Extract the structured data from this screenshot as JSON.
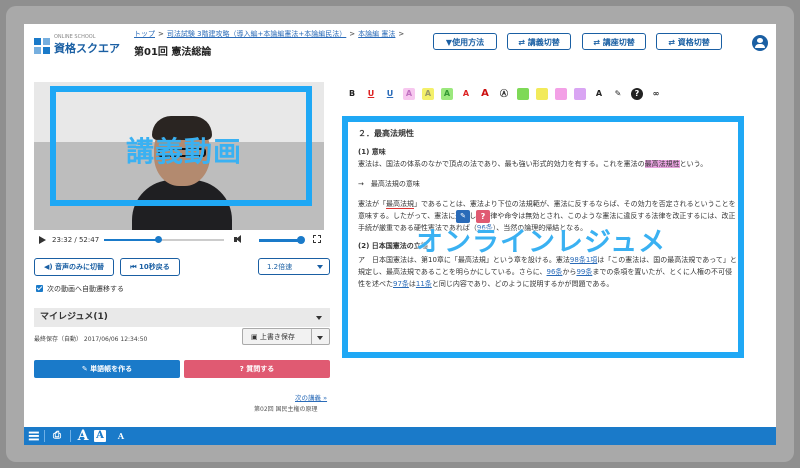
{
  "header": {
    "logo_small": "ONLINE SCHOOL",
    "logo_name": "資格スクエア",
    "breadcrumb": [
      "トップ",
      "司法試験 3階建攻略（導入編+本論編憲法+本論編民法）",
      "本論編 憲法"
    ],
    "lecture_title": "第01回 憲法総論",
    "buttons": {
      "usage": "▼使用方法",
      "lecture_switch": "⇄ 講義切替",
      "course_switch": "⇄ 講座切替",
      "qualification_switch": "⇄ 資格切替"
    },
    "user_icon": "user-icon"
  },
  "video": {
    "caption": "講義動画",
    "time": "23:32 / 52:47",
    "progress": 0.45,
    "volume": 1.0
  },
  "controls": {
    "audio_only": "音声のみに切替",
    "back10": "10秒戻る",
    "speed": "1.2倍速",
    "autoplay_label": "次の動画へ自動遷移する",
    "autoplay_checked": true
  },
  "resume": {
    "title": "マイレジュメ(1)",
    "autosave": "最終保存（自動） 2017/06/06 12:34:50",
    "overwrite": "上書き保存",
    "vocab_button": "単語帳を作る",
    "question_button": "質問する",
    "accent_blue": "#1a7ac9",
    "accent_red": "#e05a72"
  },
  "next": {
    "link": "次の講義 »",
    "title": "第02回 国民主権の原理"
  },
  "toolbar": {
    "tools": [
      {
        "name": "bold-tool",
        "glyph": "B",
        "color": "#222",
        "bg": ""
      },
      {
        "name": "underline-red-tool",
        "glyph": "U",
        "color": "#d22",
        "bg": ""
      },
      {
        "name": "underline-blue-tool",
        "glyph": "U",
        "color": "#2a6bb8",
        "bg": ""
      },
      {
        "name": "highlight-pink-tool",
        "glyph": "A",
        "color": "#c070c0",
        "bg": "#f7c7ef"
      },
      {
        "name": "highlight-yellow-tool",
        "glyph": "A",
        "color": "#996",
        "bg": "#f4f06a"
      },
      {
        "name": "highlight-green-tool",
        "glyph": "A",
        "color": "#393",
        "bg": "#9be87d"
      },
      {
        "name": "text-red-tool",
        "glyph": "A",
        "color": "#d22",
        "bg": ""
      },
      {
        "name": "text-large-tool",
        "glyph": "A",
        "color": "#c11",
        "bg": ""
      },
      {
        "name": "circle-tool",
        "glyph": "Ⓐ",
        "color": "#222",
        "bg": ""
      },
      {
        "name": "sticky-green-tool",
        "glyph": "",
        "color": "#222",
        "bg": "#7ed957"
      },
      {
        "name": "sticky-yellow-tool",
        "glyph": "",
        "color": "#222",
        "bg": "#f2ea5a"
      },
      {
        "name": "sticky-pink-tool",
        "glyph": "",
        "color": "#222",
        "bg": "#f3a0e6"
      },
      {
        "name": "sticky-purple-tool",
        "glyph": "",
        "color": "#222",
        "bg": "#d9a5f3"
      },
      {
        "name": "text-size-tool",
        "glyph": "A",
        "color": "#222",
        "bg": ""
      },
      {
        "name": "vocab-tool",
        "glyph": "✎",
        "color": "#222",
        "bg": ""
      },
      {
        "name": "question-tool",
        "glyph": "?",
        "color": "#fff",
        "bg": "#222"
      },
      {
        "name": "link-tool",
        "glyph": "∞",
        "color": "#222",
        "bg": ""
      }
    ]
  },
  "document": {
    "overlay_caption": "オンラインレジュメ",
    "heading": "２．最高法規性",
    "sub1": "(1) 意味",
    "para1_before": "憲法は、国法の体系のなかで頂点の法であり、最も強い形式的効力を有する。これを憲法の",
    "para1_highlight": "最高法規性",
    "para1_after": "という。",
    "arrow_line": "→　最高法規の意味",
    "para2_a": "憲法が「",
    "para2_hl": "最高法規",
    "para2_b": "」であることは、憲法より下位の法規範が、憲法に反するならば、その効力を否定されるということを意味する。したがって、憲法に違反した法律や命令は無効とされ、このような憲法に違反する法律を改正するには、改正手続が厳重である硬性憲法であれば（",
    "para2_link": "96条",
    "para2_c": "）、当然の論理的帰結となる。",
    "sub2": "(2) 日本国憲法の立場",
    "para3_a": "ア　日本国憲法は、第10章に「最高法規」という章を設ける。憲法",
    "para3_link1": "98条1項",
    "para3_b": "は「この憲法は、国の最高法規であって」と規定し、最高法規であることを明らかにしている。さらに、",
    "para3_link2": "96条",
    "para3_c": "から",
    "para3_link3": "99条",
    "para3_d": "までの条項を置いたが、とくに人権の不可侵性を述べた",
    "para3_link4": "97条",
    "para3_e": "は",
    "para3_link5": "11条",
    "para3_f": "と同じ内容であり、どのように説明するかが問題である。"
  },
  "bottombar": {
    "menu_icon": "menu-icon",
    "print_icon": "print-icon",
    "font_large": "A",
    "font_medium": "A",
    "font_small": "A"
  }
}
